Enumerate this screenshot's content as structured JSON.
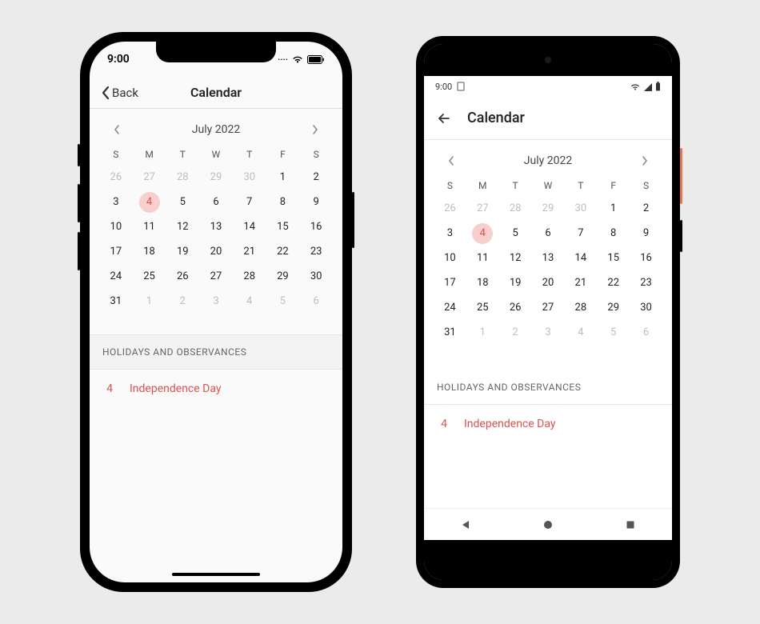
{
  "ios": {
    "status_time": "9:00",
    "back_label": "Back",
    "nav_title": "Calendar"
  },
  "android": {
    "status_time": "9:00",
    "appbar_title": "Calendar"
  },
  "calendar": {
    "month_label": "July 2022",
    "dow": [
      "S",
      "M",
      "T",
      "W",
      "T",
      "F",
      "S"
    ],
    "weeks": [
      [
        {
          "n": "26",
          "other": true
        },
        {
          "n": "27",
          "other": true
        },
        {
          "n": "28",
          "other": true
        },
        {
          "n": "29",
          "other": true
        },
        {
          "n": "30",
          "other": true
        },
        {
          "n": "1"
        },
        {
          "n": "2"
        }
      ],
      [
        {
          "n": "3"
        },
        {
          "n": "4",
          "selected": true
        },
        {
          "n": "5"
        },
        {
          "n": "6"
        },
        {
          "n": "7"
        },
        {
          "n": "8"
        },
        {
          "n": "9"
        }
      ],
      [
        {
          "n": "10"
        },
        {
          "n": "11"
        },
        {
          "n": "12"
        },
        {
          "n": "13"
        },
        {
          "n": "14"
        },
        {
          "n": "15"
        },
        {
          "n": "16"
        }
      ],
      [
        {
          "n": "17"
        },
        {
          "n": "18"
        },
        {
          "n": "19"
        },
        {
          "n": "20"
        },
        {
          "n": "21"
        },
        {
          "n": "22"
        },
        {
          "n": "23"
        }
      ],
      [
        {
          "n": "24"
        },
        {
          "n": "25"
        },
        {
          "n": "26"
        },
        {
          "n": "27"
        },
        {
          "n": "28"
        },
        {
          "n": "29"
        },
        {
          "n": "30"
        }
      ],
      [
        {
          "n": "31"
        },
        {
          "n": "1",
          "other": true
        },
        {
          "n": "2",
          "other": true
        },
        {
          "n": "3",
          "other": true
        },
        {
          "n": "4",
          "other": true
        },
        {
          "n": "5",
          "other": true
        },
        {
          "n": "6",
          "other": true
        }
      ]
    ]
  },
  "holidays": {
    "section_title": "HOLIDAYS AND OBSERVANCES",
    "items": [
      {
        "day": "4",
        "label": "Independence Day"
      }
    ]
  },
  "colors": {
    "accent": "#d9534f",
    "selected_bg": "#f8cfcf"
  }
}
